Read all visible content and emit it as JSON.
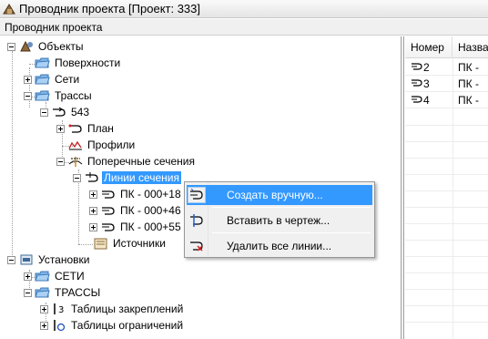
{
  "window": {
    "title": "Проводник проекта [Проект: 333]",
    "menu_label": "Проводник проекта"
  },
  "tree": {
    "objects": "Объекты",
    "surfaces": "Поверхности",
    "networks": "Сети",
    "alignments": "Трассы",
    "alignment_543": "543",
    "plan": "План",
    "profiles": "Профили",
    "cross_sections": "Поперечные сечения",
    "section_lines": "Линии сечения",
    "pk_1": "ПК - 000+18",
    "pk_2": "ПК - 000+46",
    "pk_3": "ПК - 000+55",
    "sources": "Источники",
    "settings": "Установки",
    "settings_networks": "СЕТИ",
    "settings_alignments": "ТРАССЫ",
    "fixation_tables": "Таблицы закреплений",
    "restriction_tables": "Таблицы ограничений"
  },
  "list": {
    "columns": [
      "Номер",
      "Назва"
    ],
    "rows": [
      {
        "number": "2",
        "name": "ПК -"
      },
      {
        "number": "3",
        "name": "ПК -"
      },
      {
        "number": "4",
        "name": "ПК -"
      }
    ]
  },
  "context_menu": {
    "items": [
      "Создать вручную...",
      "Вставить в чертеж...",
      "Удалить все линии..."
    ],
    "highlighted_index": 0
  }
}
